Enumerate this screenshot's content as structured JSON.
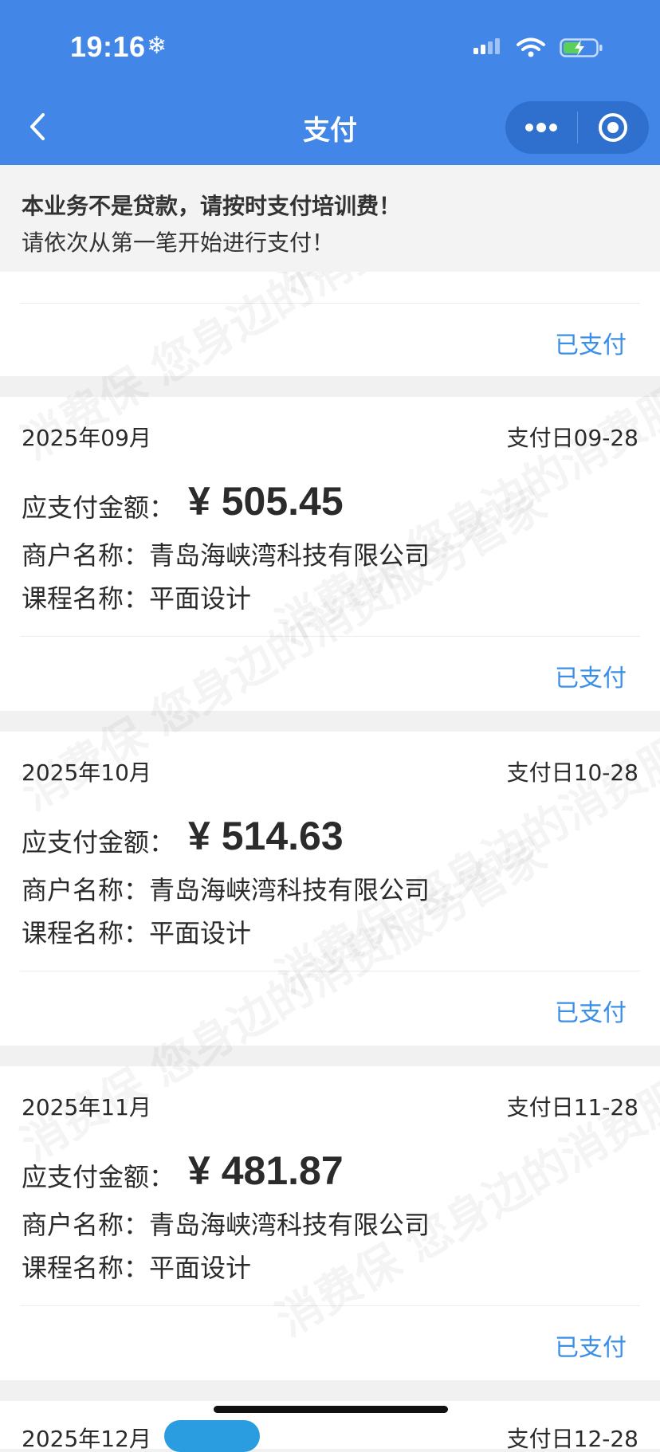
{
  "status_bar": {
    "time": "19:16"
  },
  "nav": {
    "title": "支付"
  },
  "notice": {
    "line1": "本业务不是贷款，请按时支付培训费！",
    "line2": "请依次从第一笔开始进行支付！"
  },
  "watermark_text": "消费保 您身边的消费服务管家",
  "labels": {
    "amount": "应支付金额：",
    "merchant": "商户名称：",
    "course": "课程名称："
  },
  "first_card": {
    "status": "已支付"
  },
  "payments": [
    {
      "month": "2025年09月",
      "due_date": "支付日09-28",
      "amount": "¥ 505.45",
      "merchant": "青岛海峡湾科技有限公司",
      "course": "平面设计",
      "status": "已支付"
    },
    {
      "month": "2025年10月",
      "due_date": "支付日10-28",
      "amount": "¥ 514.63",
      "merchant": "青岛海峡湾科技有限公司",
      "course": "平面设计",
      "status": "已支付"
    },
    {
      "month": "2025年11月",
      "due_date": "支付日11-28",
      "amount": "¥ 481.87",
      "merchant": "青岛海峡湾科技有限公司",
      "course": "平面设计",
      "status": "已支付"
    }
  ],
  "partial_card": {
    "month": "2025年12月",
    "due_date": "支付日12-28"
  }
}
